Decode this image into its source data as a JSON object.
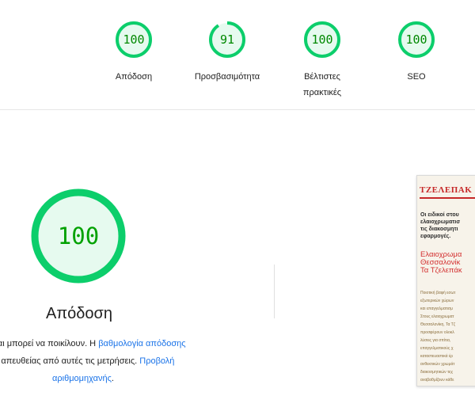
{
  "summary_gauges": [
    {
      "score": "100",
      "value": 100,
      "label_lines": [
        "Απόδοση"
      ],
      "color": "#0cce6b"
    },
    {
      "score": "91",
      "value": 91,
      "label_lines": [
        "Προσβασιμότητα"
      ],
      "color": "#0cce6b"
    },
    {
      "score": "100",
      "value": 100,
      "label_lines": [
        "Βέλτιστες",
        "πρακτικές"
      ],
      "color": "#0cce6b"
    },
    {
      "score": "100",
      "value": 100,
      "label_lines": [
        "SEO"
      ],
      "color": "#0cce6b"
    }
  ],
  "performance": {
    "score": "100",
    "value": 100,
    "title": "Απόδοση",
    "description_line1_prefix": "ται και μπορεί να ποικίλουν. Η ",
    "description_link1": "βαθμολογία απόδοσης",
    "description_line2_link": "αι",
    "description_line2_mid": " απευθείας από αυτές τις μετρήσεις. ",
    "description_link2": "Προβολή",
    "description_line3_link": "αριθμομηχανής",
    "description_line3_suffix": "."
  },
  "screenshot_thumb": {
    "logo": "ΤΖΕΛΕΠΑΚ",
    "headline_lines": [
      "Οι ειδικοί στου",
      "ελαιοχρωματισ",
      "τις διακοσμητι",
      "εφαρμογές."
    ],
    "red_lines": [
      "Ελαιοχρωμα",
      "Θεσσαλονίκ",
      "Τα Τζελεπάκ"
    ],
    "body_lines": [
      "Ποιοτική βαφή εσωτ",
      "εξωτερικών χώρων",
      "και επαγγελματισμ",
      "Στους ελαιοχρωματ",
      "Θεσσαλονίκη, Τα Τζ",
      "προσφέρουν ολοκλ",
      "λύσεις για σπίτια,",
      "επαγγελματικούς χ",
      "καταστευαστικά έρ",
      "ανθεκτικών χρωμάτ",
      "διακοσμητικών τεχ",
      "αναβαθμίζουν κάθε"
    ]
  },
  "colors": {
    "pass_ring": "#0cce6b",
    "pass_fill": "#e6faef",
    "pass_text": "#008800",
    "link": "#1a73e8"
  }
}
